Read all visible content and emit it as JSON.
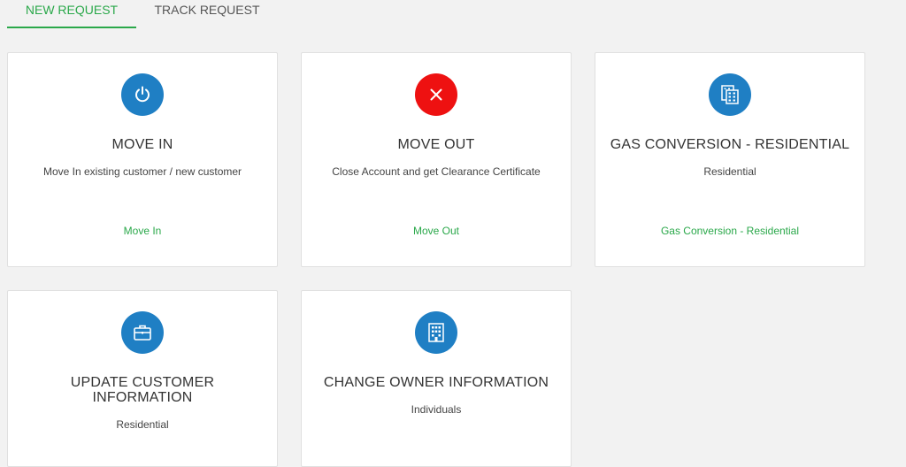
{
  "tabs": [
    {
      "label": "NEW REQUEST",
      "active": true
    },
    {
      "label": "TRACK REQUEST",
      "active": false
    }
  ],
  "colors": {
    "accent": "#2aa84a",
    "icon_blue": "#1f7fc4",
    "icon_red": "#ee1111"
  },
  "cards": [
    {
      "icon": "power-icon",
      "title": "MOVE IN",
      "desc": "Move In existing customer / new customer",
      "link": "Move In"
    },
    {
      "icon": "close-icon",
      "title": "MOVE OUT",
      "desc": "Close Account and get Clearance Certificate",
      "link": "Move Out"
    },
    {
      "icon": "building-icon",
      "title": "GAS CONVERSION - RESIDENTIAL",
      "desc": "Residential",
      "link": "Gas Conversion - Residential"
    },
    {
      "icon": "briefcase-icon",
      "title": "UPDATE CUSTOMER INFORMATION",
      "desc": "Residential",
      "link": ""
    },
    {
      "icon": "building-icon",
      "title": "CHANGE OWNER INFORMATION",
      "desc": "Individuals",
      "link": ""
    }
  ]
}
